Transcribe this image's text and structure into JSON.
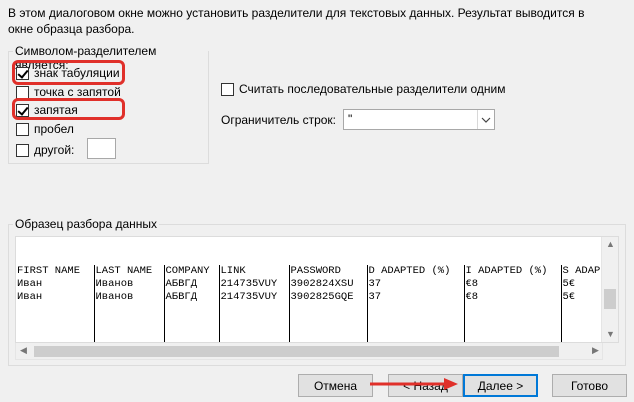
{
  "description": "В этом диалоговом окне можно установить разделители для текстовых данных. Результат выводится в окне образца разбора.",
  "delimiters": {
    "title": "Символом-разделителем является:",
    "items": [
      {
        "label": "знак табуляции",
        "checked": true
      },
      {
        "label": "точка с запятой",
        "checked": false
      },
      {
        "label": "запятая",
        "checked": true
      },
      {
        "label": "пробел",
        "checked": false
      },
      {
        "label": "другой:",
        "checked": false
      }
    ]
  },
  "options": {
    "consecutive_label": "Считать последовательные разделители одним",
    "consecutive_checked": false,
    "qualifier_label": "Ограничитель строк:",
    "qualifier_value": "\""
  },
  "preview": {
    "title": "Образец разбора данных",
    "rows": [
      [
        "FIRST NAME",
        "LAST NAME",
        "COMPANY",
        "LINK",
        "PASSWORD",
        "D ADAPTED (%)",
        "I ADAPTED (%)",
        "S ADAP"
      ],
      [
        "Иван",
        "Иванов",
        "АБВГД",
        "214735VUY",
        "3902824XSU",
        "37",
        "€8",
        "5€"
      ],
      [
        "Иван",
        "Иванов",
        "АБВГД",
        "214735VUY",
        "3902825GQE",
        "37",
        "€8",
        "5€"
      ],
      [
        "",
        "",
        "",
        "",
        "",
        "",
        "",
        ""
      ]
    ]
  },
  "buttons": {
    "cancel": "Отмена",
    "back": "< Назад",
    "next": "Далее >",
    "finish": "Готово"
  },
  "colors": {
    "highlight": "#e0302a",
    "focus": "#0078d7"
  }
}
